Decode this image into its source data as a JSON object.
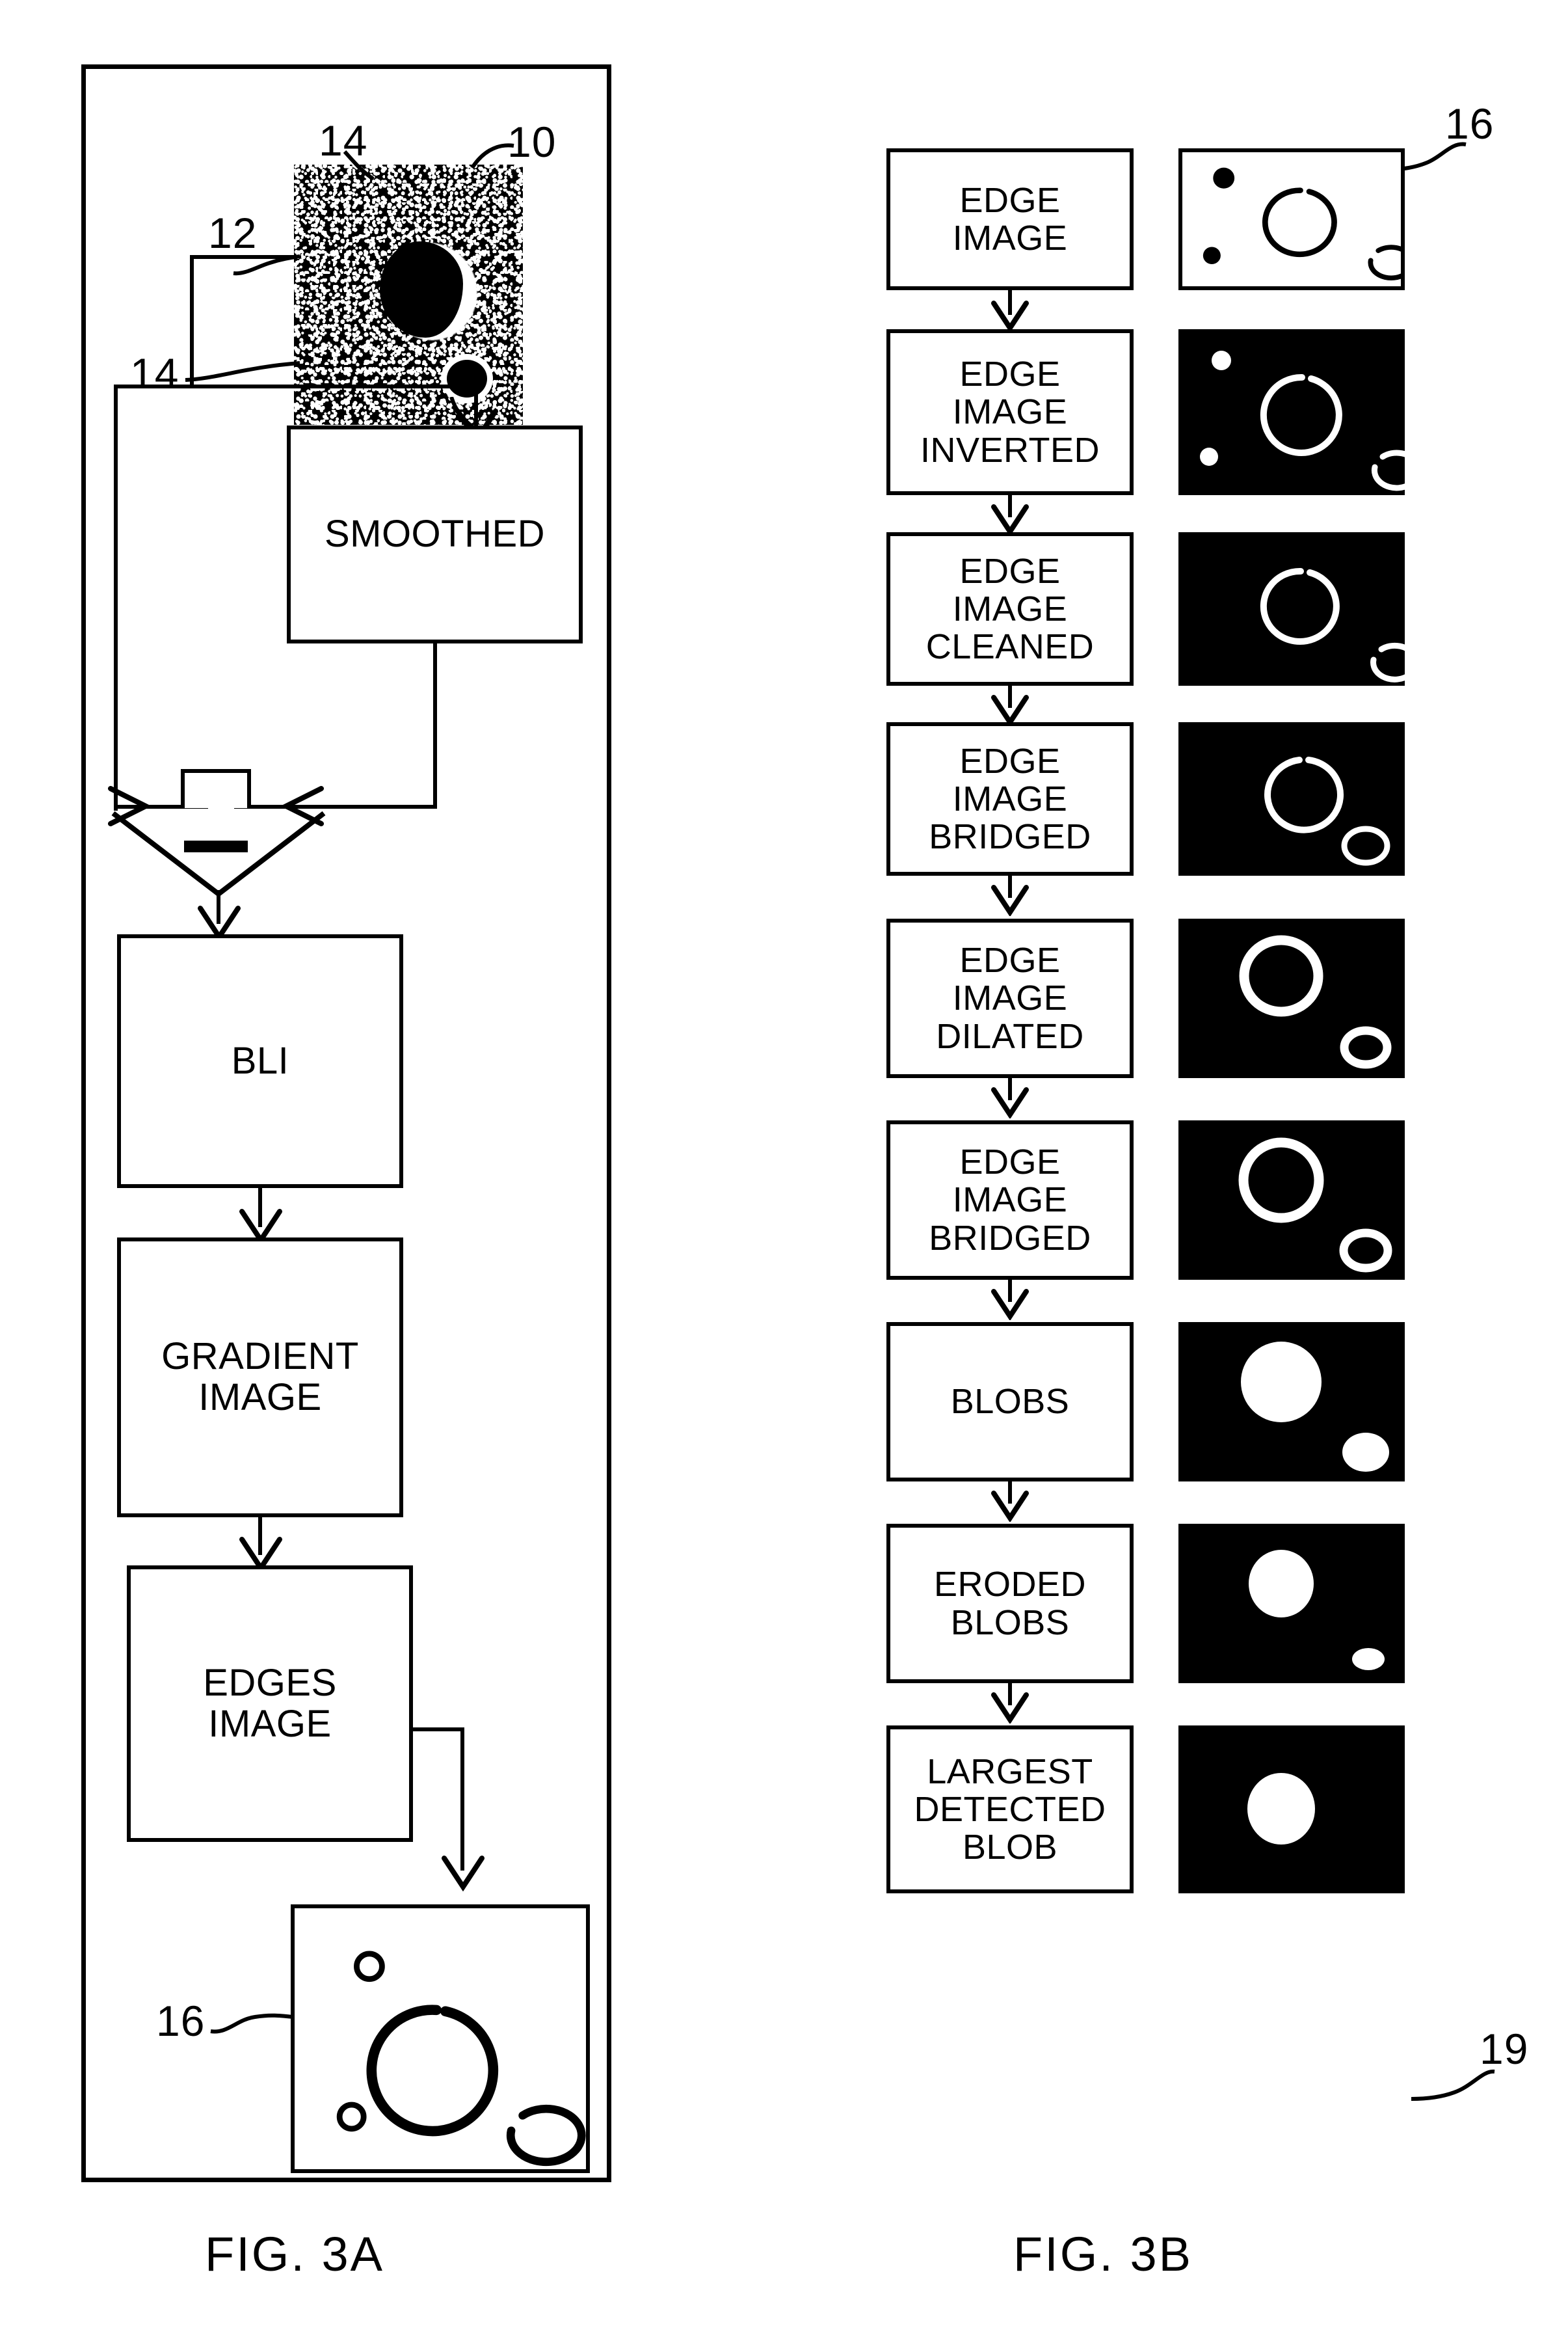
{
  "figures": [
    {
      "id": "fig-3a",
      "caption": "FIG. 3A",
      "reference_numerals": [
        {
          "label": "14",
          "target": "noise-top"
        },
        {
          "label": "10",
          "target": "source-image"
        },
        {
          "label": "12",
          "target": "lesion"
        },
        {
          "label": "14",
          "target": "noise-left"
        },
        {
          "label": "14",
          "target": "noise-bottom"
        },
        {
          "label": "16",
          "target": "edge-image-result"
        }
      ],
      "nodes": [
        {
          "id": "source-image",
          "type": "image",
          "kind": "speckle-noise",
          "label": ""
        },
        {
          "id": "smoothed",
          "type": "process",
          "lines": [
            "SMOOTHED"
          ]
        },
        {
          "id": "divide-junction",
          "type": "operator",
          "symbol": "divide"
        },
        {
          "id": "bli",
          "type": "process",
          "lines": [
            "BLI"
          ]
        },
        {
          "id": "gradient-image",
          "type": "process",
          "lines": [
            "GRADIENT",
            "IMAGE"
          ]
        },
        {
          "id": "edges-image",
          "type": "process",
          "lines": [
            "EDGES",
            "IMAGE"
          ]
        },
        {
          "id": "edge-image-result",
          "type": "image",
          "kind": "edge-outline",
          "label": ""
        }
      ]
    },
    {
      "id": "fig-3b",
      "caption": "FIG. 3B",
      "reference_numerals": [
        {
          "label": "16",
          "target": "row-0-image"
        },
        {
          "label": "19",
          "target": "row-8-image"
        }
      ],
      "rows": [
        {
          "lines": [
            "EDGE",
            "IMAGE"
          ],
          "image": "edge"
        },
        {
          "lines": [
            "EDGE",
            "IMAGE",
            "INVERTED"
          ],
          "image": "inverted"
        },
        {
          "lines": [
            "EDGE",
            "IMAGE",
            "CLEANED"
          ],
          "image": "cleaned"
        },
        {
          "lines": [
            "EDGE",
            "IMAGE",
            "BRIDGED"
          ],
          "image": "bridged1"
        },
        {
          "lines": [
            "EDGE",
            "IMAGE",
            "DILATED"
          ],
          "image": "dilated"
        },
        {
          "lines": [
            "EDGE",
            "IMAGE",
            "BRIDGED"
          ],
          "image": "bridged2"
        },
        {
          "lines": [
            "BLOBS"
          ],
          "image": "blobs"
        },
        {
          "lines": [
            "ERODED",
            "BLOBS"
          ],
          "image": "eroded"
        },
        {
          "lines": [
            "LARGEST",
            "DETECTED",
            "BLOB"
          ],
          "image": "largest"
        }
      ]
    }
  ],
  "colors": {
    "ink": "#000000",
    "paper": "#ffffff"
  }
}
